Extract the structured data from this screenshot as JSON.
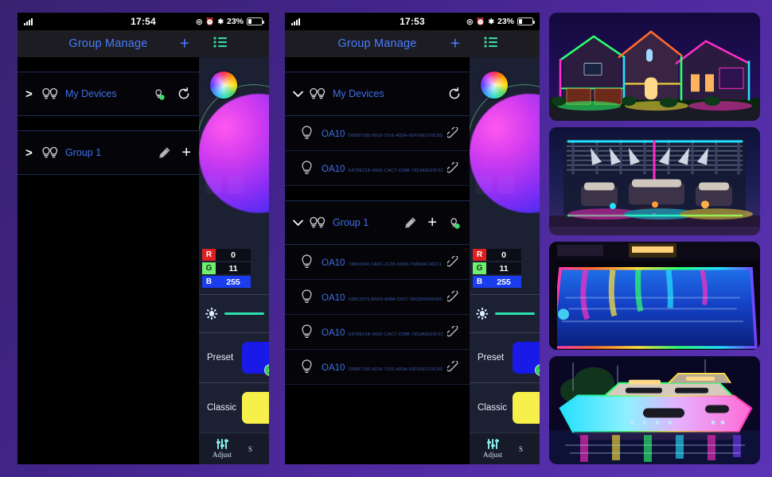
{
  "background": {
    "color": "#42248a"
  },
  "phones": [
    {
      "id": "phone-collapsed",
      "status": {
        "time": "17:54",
        "battery": "23%",
        "icons": [
          "location-icon",
          "alarm-icon",
          "bluetooth-icon"
        ]
      },
      "nav": {
        "title": "Group Manage",
        "add_label": "+"
      },
      "groups": [
        {
          "chevron": ">",
          "name": "My Devices",
          "actions": [
            "share-bulb-icon",
            "refresh-icon"
          ],
          "expanded": false,
          "devices": []
        },
        {
          "chevron": ">",
          "name": "Group 1",
          "actions": [
            "edit-icon",
            "add-icon"
          ],
          "expanded": false,
          "devices": []
        }
      ]
    },
    {
      "id": "phone-expanded",
      "status": {
        "time": "17:53",
        "battery": "23%",
        "icons": [
          "location-icon",
          "alarm-icon",
          "bluetooth-icon"
        ]
      },
      "nav": {
        "title": "Group Manage",
        "add_label": "+"
      },
      "groups": [
        {
          "chevron": "v",
          "name": "My Devices",
          "actions": [
            "refresh-icon"
          ],
          "expanded": true,
          "devices": [
            {
              "name": "OA10",
              "uuid": "D08B7185-8018-7516-A59A-65F00ECF9C6D"
            },
            {
              "name": "OA10",
              "uuid": "E878E21B-666F-CAC7-C58B-7953A8320F22"
            }
          ]
        },
        {
          "chevron": "v",
          "name": "Group 1",
          "actions": [
            "edit-icon",
            "add-icon",
            "share-bulb-icon"
          ],
          "expanded": true,
          "devices": [
            {
              "name": "OA10",
              "uuid": "7A800340-14DC-2C95-59D8-76804AC40211"
            },
            {
              "name": "OA10",
              "uuid": "538C3970-B5D5-848A-D0C7-06C859692450"
            },
            {
              "name": "OA10",
              "uuid": "E878E21B-666F-CAC7-C58B-7953A8320F22"
            },
            {
              "name": "OA10",
              "uuid": "D08B7185-8018-7516-A59A-65F00ECF9C6D"
            }
          ]
        }
      ]
    }
  ],
  "rail": {
    "menu_icon": "list-icon",
    "wheel_icon": "color-wheel-icon",
    "rgb": {
      "r_label": "R",
      "r_value": "0",
      "g_label": "G",
      "g_value": "11",
      "b_label": "B",
      "b_value": "255"
    },
    "brightness": {
      "icon": "brightness-icon",
      "track_color": "#2de0b0"
    },
    "preset": {
      "label": "Preset",
      "swatch_color": "#1a1ae8",
      "selected": true
    },
    "classic": {
      "label": "Classic",
      "swatch_color": "#f7ef4a",
      "selected": false
    },
    "tabs": [
      {
        "icon": "sliders-icon",
        "label": "Adjust"
      },
      {
        "label": "S"
      }
    ]
  },
  "photos": [
    {
      "name": "house-rgb-lighting",
      "alt": "House exterior outlined in RGB permanent lights"
    },
    {
      "name": "pergola-patio-lighting",
      "alt": "Patio pergola with RGB neon outline"
    },
    {
      "name": "swimming-pool-lighting",
      "alt": "Swimming pool edged with RGB light strip"
    },
    {
      "name": "yacht-lighting",
      "alt": "Yacht outlined with RGB lights at night"
    }
  ]
}
